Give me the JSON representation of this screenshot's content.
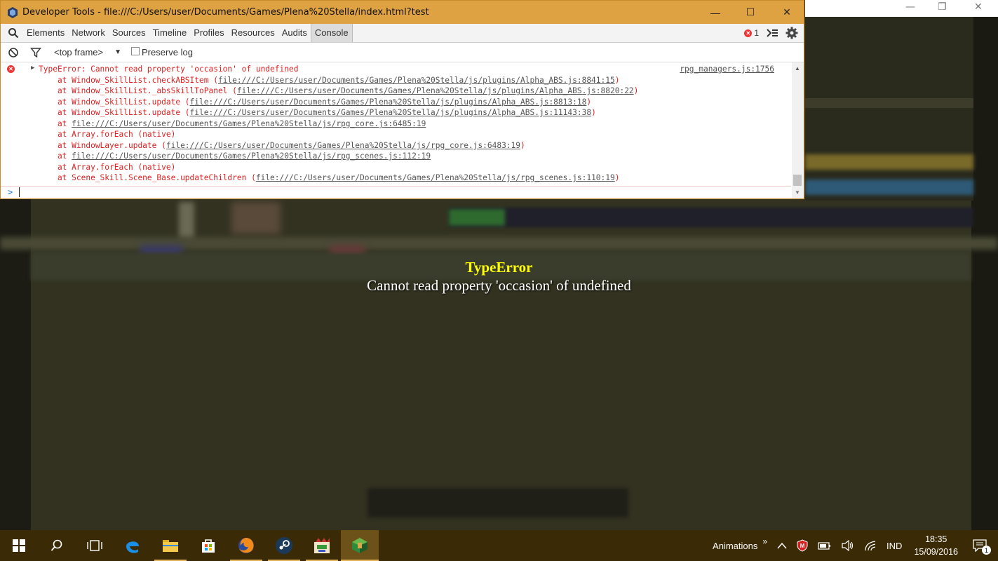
{
  "devtools": {
    "window_title": "Developer Tools - file:///C:/Users/user/Documents/Games/Plena%20Stella/index.html?test",
    "window_controls": {
      "minimize": "—",
      "maximize": "☐",
      "close": "✕"
    },
    "tabs": [
      {
        "label": "Elements"
      },
      {
        "label": "Network"
      },
      {
        "label": "Sources"
      },
      {
        "label": "Timeline"
      },
      {
        "label": "Profiles"
      },
      {
        "label": "Resources"
      },
      {
        "label": "Audits"
      },
      {
        "label": "Console",
        "active": true
      }
    ],
    "error_count": "1",
    "console_toolbar": {
      "frame_selector": "<top frame>",
      "frame_arrow": "▼",
      "preserve_log_label": "Preserve log",
      "preserve_log_checked": false
    },
    "error": {
      "message": "TypeError: Cannot read property 'occasion' of undefined",
      "source": "rpg_managers.js:1756",
      "stack": [
        {
          "text": "    at Window_SkillList.checkABSItem (",
          "link": "file:///C:/Users/user/Documents/Games/Plena%20Stella/js/plugins/Alpha_ABS.js:8841:15",
          "tail": ")"
        },
        {
          "text": "    at Window_SkillList._absSkillToPanel (",
          "link": "file:///C:/Users/user/Documents/Games/Plena%20Stella/js/plugins/Alpha_ABS.js:8820:22",
          "tail": ")"
        },
        {
          "text": "    at Window_SkillList.update (",
          "link": "file:///C:/Users/user/Documents/Games/Plena%20Stella/js/plugins/Alpha_ABS.js:8813:18",
          "tail": ")"
        },
        {
          "text": "    at Window_SkillList.update (",
          "link": "file:///C:/Users/user/Documents/Games/Plena%20Stella/js/plugins/Alpha_ABS.js:11143:38",
          "tail": ")"
        },
        {
          "text": "    at ",
          "link": "file:///C:/Users/user/Documents/Games/Plena%20Stella/js/rpg_core.js:6485:19",
          "tail": ""
        },
        {
          "text": "    at Array.forEach (native)",
          "link": "",
          "tail": ""
        },
        {
          "text": "    at WindowLayer.update (",
          "link": "file:///C:/Users/user/Documents/Games/Plena%20Stella/js/rpg_core.js:6483:19",
          "tail": ")"
        },
        {
          "text": "    at ",
          "link": "file:///C:/Users/user/Documents/Games/Plena%20Stella/js/rpg_scenes.js:112:19",
          "tail": ""
        },
        {
          "text": "    at Array.forEach (native)",
          "link": "",
          "tail": ""
        },
        {
          "text": "    at Scene_Skill.Scene_Base.updateChildren (",
          "link": "file:///C:/Users/user/Documents/Games/Plena%20Stella/js/rpg_scenes.js:110:19",
          "tail": ")"
        }
      ],
      "prompt": ">"
    }
  },
  "game": {
    "error_title": "TypeError",
    "error_message": "Cannot read property 'occasion' of undefined",
    "window_controls": {
      "minimize": "—",
      "restore": "❐",
      "close": "✕"
    }
  },
  "taskbar": {
    "tray_label": "Animations",
    "overflow": "»",
    "language": "IND",
    "time": "18:35",
    "date": "15/09/2016",
    "notification_count": "1",
    "apps": [
      "start",
      "search",
      "task-view",
      "edge",
      "file-explorer",
      "store",
      "firefox",
      "steam",
      "rpg-maker",
      "game"
    ]
  },
  "colors": {
    "titlebar": "#dea242",
    "taskbar": "#3a2a05",
    "error_red": "#e02020",
    "error_yellow": "#ffff00"
  }
}
